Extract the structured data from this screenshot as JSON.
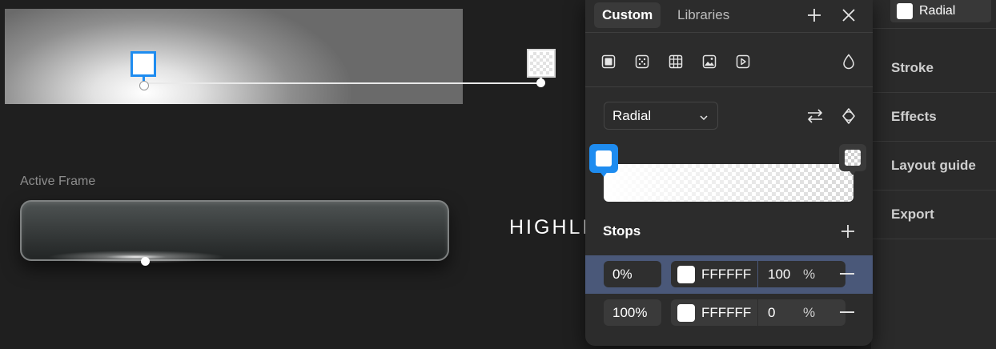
{
  "canvas": {
    "frame_label": "Active Frame",
    "highlight_text": "HIGHLIGHT"
  },
  "right_panel": {
    "fill_chip_label": "Radial",
    "sections": [
      "Stroke",
      "Effects",
      "Layout guide",
      "Export"
    ]
  },
  "popover": {
    "tabs": [
      "Custom",
      "Libraries"
    ],
    "active_tab": "Custom",
    "fill_types": [
      "solid-fill-icon",
      "pattern-fill-icon",
      "table-fill-icon",
      "image-fill-icon",
      "video-fill-icon"
    ],
    "gradient_type": "Radial",
    "stops_title": "Stops",
    "stops": [
      {
        "position": "0%",
        "hex": "FFFFFF",
        "opacity": "100",
        "unit": "%",
        "selected": true
      },
      {
        "position": "100%",
        "hex": "FFFFFF",
        "opacity": "0",
        "unit": "%",
        "selected": false
      }
    ]
  },
  "colors": {
    "accent": "#1e8cf0",
    "selected_row": "#4a5879",
    "panel_bg": "#2c2c2c"
  }
}
